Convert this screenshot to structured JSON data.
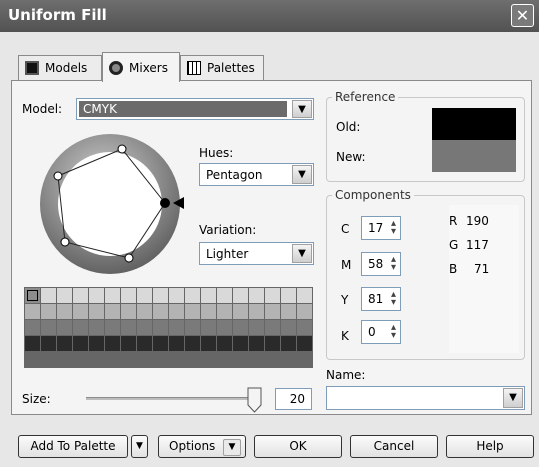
{
  "window": {
    "title": "Uniform Fill",
    "close_glyph": "✕"
  },
  "tabs": [
    {
      "label": "Models",
      "icon": "models-icon"
    },
    {
      "label": "Mixers",
      "icon": "mixers-icon"
    },
    {
      "label": "Palettes",
      "icon": "palettes-icon"
    }
  ],
  "model": {
    "label": "Model:",
    "value": "CMYK"
  },
  "hues": {
    "label": "Hues:",
    "value": "Pentagon"
  },
  "variation": {
    "label": "Variation:",
    "value": "Lighter"
  },
  "reference": {
    "label": "Reference",
    "old_label": "Old:",
    "new_label": "New:",
    "old_color": "#000000",
    "new_color": "#777777"
  },
  "components": {
    "label": "Components",
    "c": {
      "label": "C",
      "value": "17"
    },
    "m": {
      "label": "M",
      "value": "58"
    },
    "y": {
      "label": "Y",
      "value": "81"
    },
    "k": {
      "label": "K",
      "value": "0"
    },
    "r": {
      "label": "R",
      "value": "190"
    },
    "g": {
      "label": "G",
      "value": "117"
    },
    "b": {
      "label": "B",
      "value": "71"
    }
  },
  "name": {
    "label": "Name:",
    "value": ""
  },
  "size": {
    "label": "Size:",
    "value": "20",
    "level": 1.0
  },
  "buttons": {
    "add_to_palette": "Add To Palette",
    "options": "Options",
    "ok": "OK",
    "cancel": "Cancel",
    "help": "Help"
  },
  "swatch_rows": [
    "#d9d9d9",
    "#b3b3b3",
    "#7a7a7a",
    "#2a2a2a",
    "#666666"
  ]
}
